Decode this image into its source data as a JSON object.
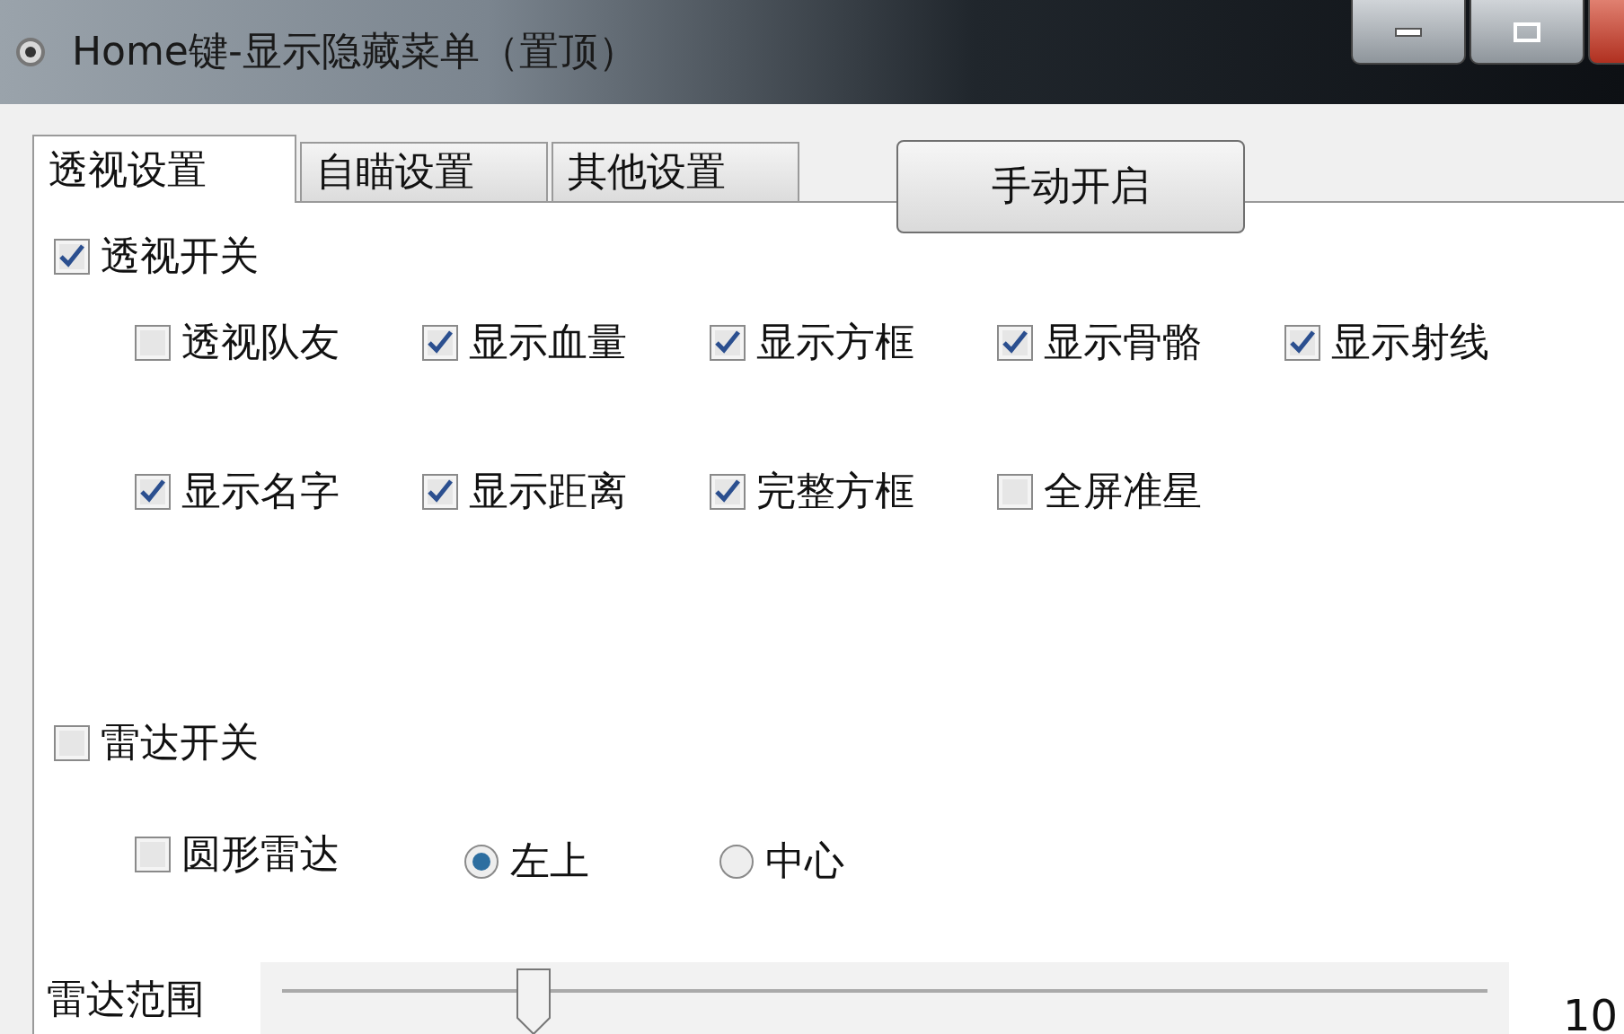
{
  "window": {
    "title": "Home键-显示隐藏菜单（置顶）"
  },
  "tabs": [
    {
      "label": "透视设置",
      "selected": true
    },
    {
      "label": "自瞄设置",
      "selected": false
    },
    {
      "label": "其他设置",
      "selected": false
    }
  ],
  "button": {
    "label": "手动开启"
  },
  "esp": {
    "toggle": {
      "label": "透视开关",
      "checked": true
    },
    "option_rows": [
      [
        {
          "label": "透视队友",
          "checked": false
        },
        {
          "label": "显示血量",
          "checked": true
        },
        {
          "label": "显示方框",
          "checked": true
        },
        {
          "label": "显示骨骼",
          "checked": true
        },
        {
          "label": "显示射线",
          "checked": true
        }
      ],
      [
        {
          "label": "显示名字",
          "checked": true
        },
        {
          "label": "显示距离",
          "checked": true
        },
        {
          "label": "完整方框",
          "checked": true
        },
        {
          "label": "全屏准星",
          "checked": false
        }
      ]
    ]
  },
  "radar": {
    "toggle": {
      "label": "雷达开关",
      "checked": false
    },
    "circular": {
      "label": "圆形雷达",
      "checked": false
    },
    "positions": [
      {
        "label": "左上",
        "selected": true
      },
      {
        "label": "中心",
        "selected": false
      }
    ],
    "range": {
      "label": "雷达范围",
      "level": 0.2,
      "reading": "10"
    }
  }
}
